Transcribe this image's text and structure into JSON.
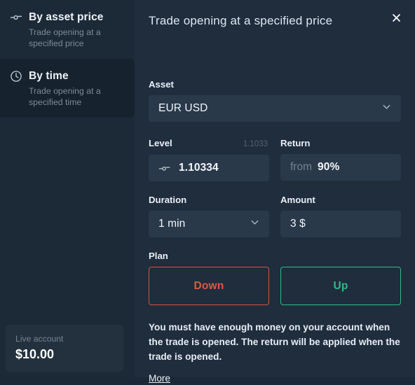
{
  "colors": {
    "app_bg": "#1c2a38",
    "panel_bg": "#1f2d3d",
    "sidebar_active_bg": "#16222e",
    "control_bg": "#2a3949",
    "account_bg": "#23313f",
    "down_accent": "#e2573f",
    "up_accent": "#2ebd85",
    "muted_text": "#7d8b98"
  },
  "sidebar": {
    "items": [
      {
        "id": "by-asset-price",
        "icon": "level-line-icon",
        "title": "By asset price",
        "subtitle": "Trade opening at a specified price",
        "active": false
      },
      {
        "id": "by-time",
        "icon": "clock-icon",
        "title": "By time",
        "subtitle": "Trade opening at a specified time",
        "active": true
      }
    ],
    "account": {
      "label": "Live account",
      "value": "$10.00"
    }
  },
  "panel": {
    "title": "Trade opening at a specified price",
    "close_icon": "close-icon"
  },
  "form": {
    "asset": {
      "label": "Asset",
      "value": "EUR USD",
      "icon": "chevron-down-icon"
    },
    "level": {
      "label": "Level",
      "hint": "1.1033",
      "value": "1.10334",
      "icon": "level-line-icon"
    },
    "return": {
      "label": "Return",
      "prefix": "from",
      "value": "90%"
    },
    "duration": {
      "label": "Duration",
      "value": "1 min",
      "icon": "chevron-down-icon"
    },
    "amount": {
      "label": "Amount",
      "value": "3 $"
    },
    "plan": {
      "label": "Plan",
      "down_label": "Down",
      "up_label": "Up"
    },
    "note": "You must have enough money on your account when the trade is opened. The return will be applied when the trade is opened.",
    "more_label": "More"
  }
}
